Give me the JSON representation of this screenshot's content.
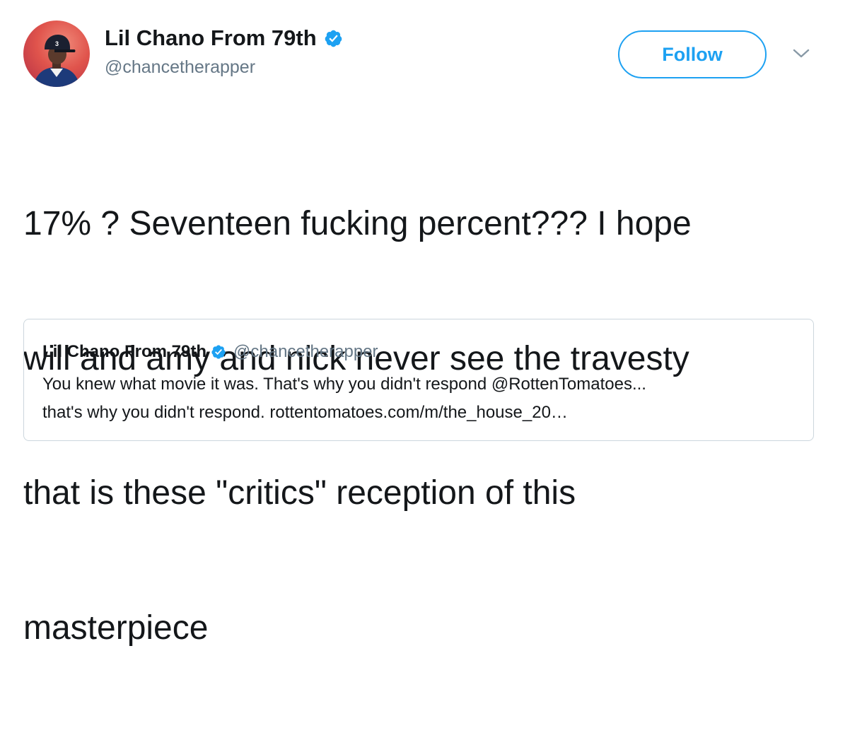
{
  "author": {
    "display_name": "Lil Chano From 79th",
    "handle": "@chancetherapper",
    "verified": true,
    "avatar_icon": "user-avatar-cap-icon"
  },
  "follow_button": {
    "label": "Follow"
  },
  "menu": {
    "icon": "chevron-down-icon"
  },
  "tweet": {
    "text_lines": [
      "17% ? Seventeen fucking percent??? I hope",
      "will and amy and nick never see the travesty",
      "that is these \"critics\" reception of this",
      "masterpiece"
    ]
  },
  "quoted_tweet": {
    "display_name": "Lil Chano From 79th",
    "handle": "@chancetherapper",
    "verified": true,
    "text_lines": [
      "You knew what movie it was. That's why you didn't respond @RottenTomatoes...",
      "that's why you didn't respond. rottentomatoes.com/m/the_house_20…"
    ]
  },
  "colors": {
    "accent": "#1da1f2",
    "text": "#14171a",
    "secondary_text": "#657786",
    "border": "#ccd6dd"
  }
}
